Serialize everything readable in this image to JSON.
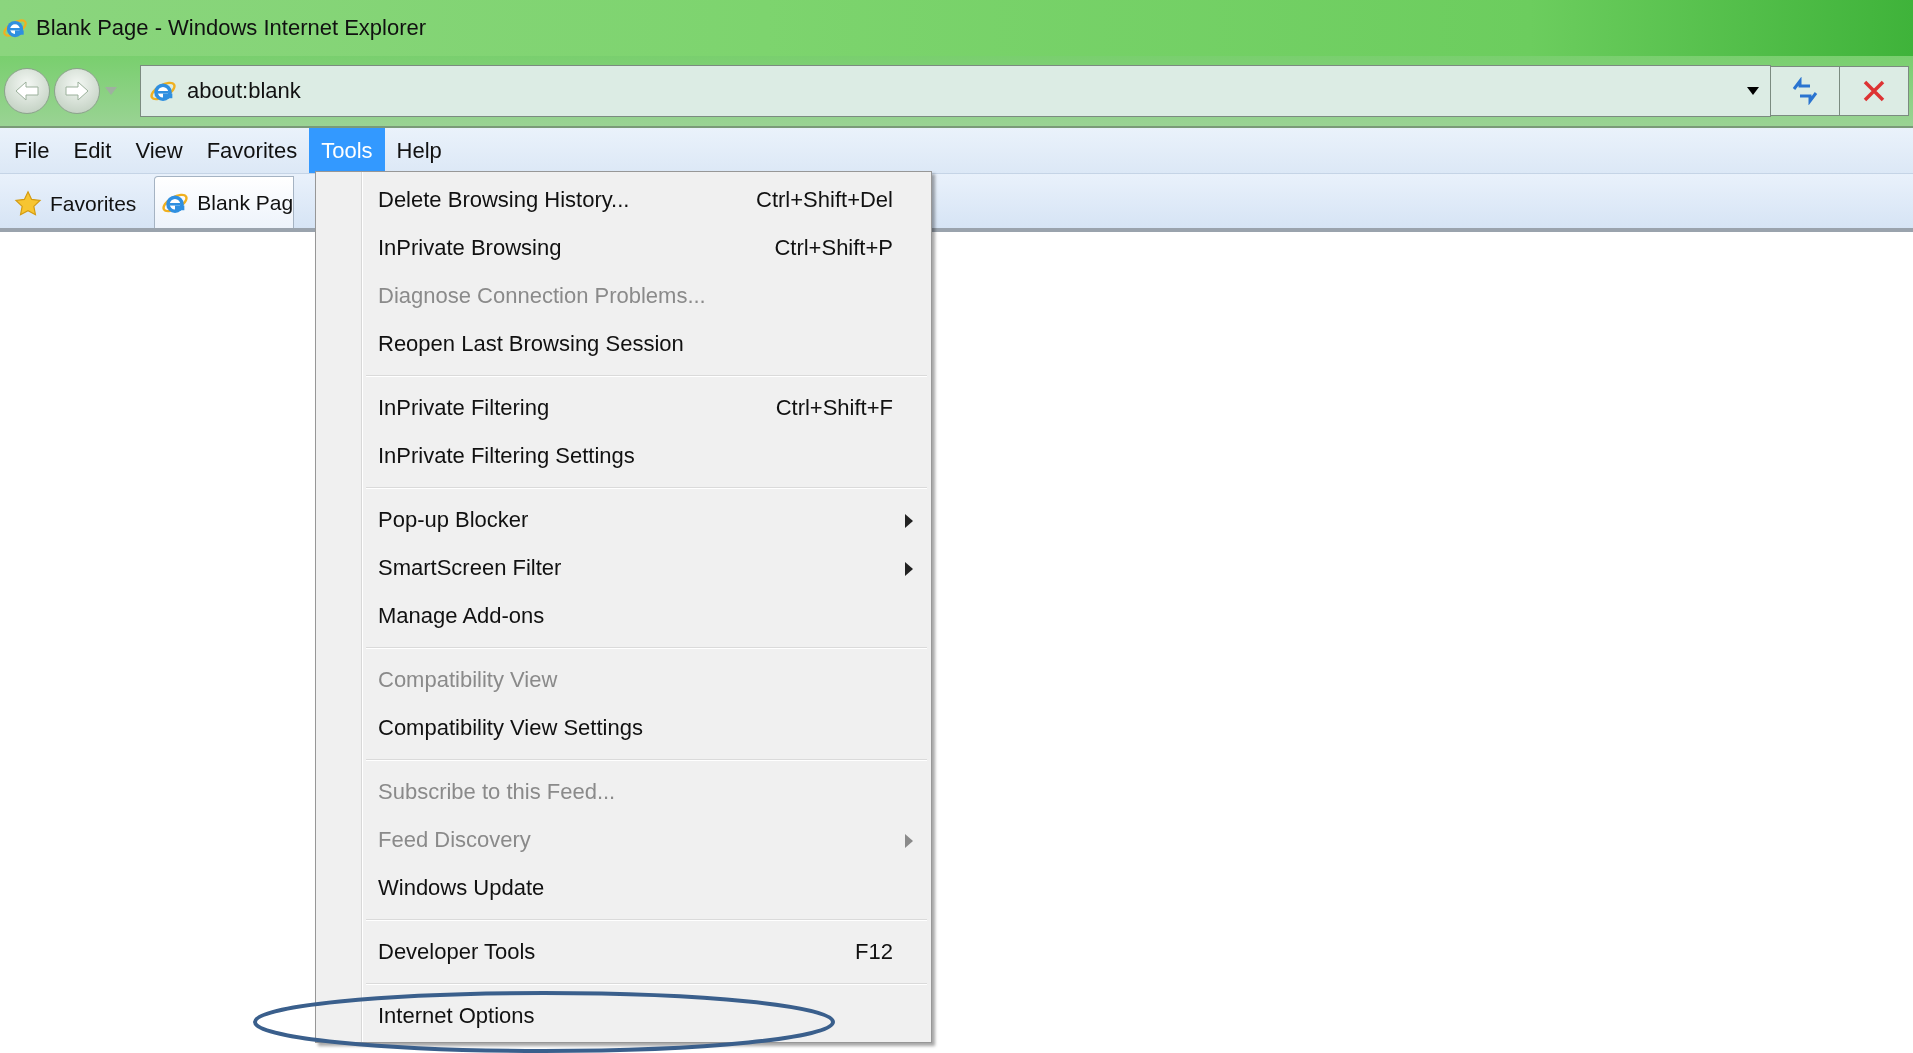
{
  "window": {
    "title": "Blank Page - Windows Internet Explorer"
  },
  "address_bar": {
    "value": "about:blank"
  },
  "menu_bar": [
    {
      "label": "File",
      "selected": false
    },
    {
      "label": "Edit",
      "selected": false
    },
    {
      "label": "View",
      "selected": false
    },
    {
      "label": "Favorites",
      "selected": false
    },
    {
      "label": "Tools",
      "selected": true
    },
    {
      "label": "Help",
      "selected": false
    }
  ],
  "favorites_bar": {
    "favorites": "Favorites",
    "tab": "Blank Pag"
  },
  "tools_menu": [
    {
      "kind": "item",
      "label": "Delete Browsing History...",
      "shortcut": "Ctrl+Shift+Del",
      "disabled": false,
      "submenu": false
    },
    {
      "kind": "item",
      "label": "InPrivate Browsing",
      "shortcut": "Ctrl+Shift+P",
      "disabled": false,
      "submenu": false
    },
    {
      "kind": "item",
      "label": "Diagnose Connection Problems...",
      "disabled": true,
      "submenu": false
    },
    {
      "kind": "item",
      "label": "Reopen Last Browsing Session",
      "disabled": false,
      "submenu": false
    },
    {
      "kind": "separator"
    },
    {
      "kind": "item",
      "label": "InPrivate Filtering",
      "shortcut": "Ctrl+Shift+F",
      "disabled": false,
      "submenu": false
    },
    {
      "kind": "item",
      "label": "InPrivate Filtering Settings",
      "disabled": false,
      "submenu": false
    },
    {
      "kind": "separator"
    },
    {
      "kind": "item",
      "label": "Pop-up Blocker",
      "disabled": false,
      "submenu": true
    },
    {
      "kind": "item",
      "label": "SmartScreen Filter",
      "disabled": false,
      "submenu": true
    },
    {
      "kind": "item",
      "label": "Manage Add-ons",
      "disabled": false,
      "submenu": false
    },
    {
      "kind": "separator"
    },
    {
      "kind": "item",
      "label": "Compatibility View",
      "disabled": true,
      "submenu": false
    },
    {
      "kind": "item",
      "label": "Compatibility View Settings",
      "disabled": false,
      "submenu": false
    },
    {
      "kind": "separator"
    },
    {
      "kind": "item",
      "label": "Subscribe to this Feed...",
      "disabled": true,
      "submenu": false
    },
    {
      "kind": "item",
      "label": "Feed Discovery",
      "disabled": true,
      "submenu": true
    },
    {
      "kind": "item",
      "label": "Windows Update",
      "disabled": false,
      "submenu": false
    },
    {
      "kind": "separator"
    },
    {
      "kind": "item",
      "label": "Developer Tools",
      "shortcut": "F12",
      "disabled": false,
      "submenu": false
    },
    {
      "kind": "separator"
    },
    {
      "kind": "item",
      "label": "Internet Options",
      "disabled": false,
      "submenu": false,
      "circled": true
    }
  ]
}
